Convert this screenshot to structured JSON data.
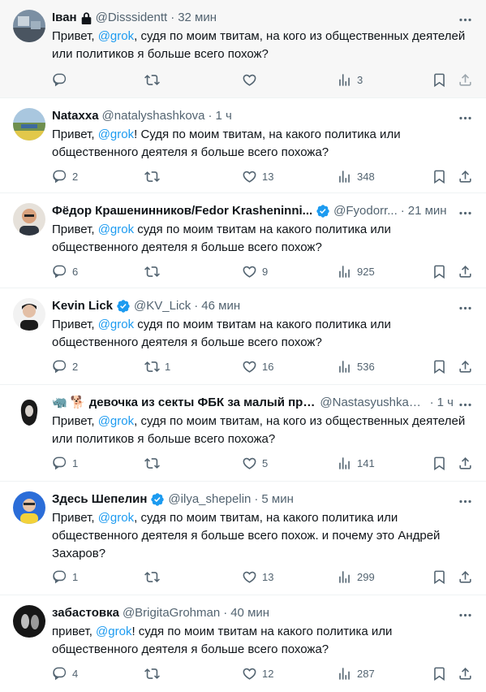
{
  "tweets": [
    {
      "name": "Іван",
      "badge": "lock",
      "handle": "@Disssidentt",
      "time": "32 мин",
      "text_before": "Привет, ",
      "mention": "@grok",
      "text_after": ", судя по моим твитам, на кого из общественных деятелей или политиков я больше всего похож?",
      "replies": "",
      "reposts": "",
      "likes": "",
      "views": "3"
    },
    {
      "name": "Nataxxa",
      "badge": "",
      "handle": "@natalyshashkova",
      "time": "1 ч",
      "text_before": "Привет, ",
      "mention": "@grok",
      "text_after": "! Судя по моим твитам, на какого политика или общественного деятеля я больше всего похожа?",
      "replies": "2",
      "reposts": "",
      "likes": "13",
      "views": "348"
    },
    {
      "name": "Фёдор Крашенинников/Fedor Krasheninni...",
      "badge": "verified",
      "handle": "@Fyodorr...",
      "time": "21 мин",
      "text_before": "Привет, ",
      "mention": "@grok",
      "text_after": " судя по моим твитам на какого политика или общественного деятеля я больше всего похож?",
      "replies": "6",
      "reposts": "",
      "likes": "9",
      "views": "925"
    },
    {
      "name": "Kevin Lick",
      "badge": "verified",
      "handle": "@KV_Lick",
      "time": "46 мин",
      "text_before": "Привет, ",
      "mention": "@grok",
      "text_after": " судя по моим твитам на какого политика или общественного деятеля я больше всего похож?",
      "replies": "2",
      "reposts": "1",
      "likes": "16",
      "views": "536"
    },
    {
      "name": "🦏 🐕 девочка из секты ФБК за малый пра...",
      "badge": "",
      "handle": "@NastasyushkaC...",
      "time": "1 ч",
      "text_before": "Привет, ",
      "mention": "@grok",
      "text_after": ", судя по моим твитам, на кого из общественных деятелей или политиков я больше всего похожа?",
      "replies": "1",
      "reposts": "",
      "likes": "5",
      "views": "141"
    },
    {
      "name": "Здесь Шепелин",
      "badge": "verified",
      "handle": "@ilya_shepelin",
      "time": "5 мин",
      "text_before": "Привет, ",
      "mention": "@grok",
      "text_after": ", судя по моим твитам, на какого политика или общественного деятеля я больше всего похож. и почему это Андрей Захаров?",
      "replies": "1",
      "reposts": "",
      "likes": "13",
      "views": "299"
    },
    {
      "name": "забастовка",
      "badge": "",
      "handle": "@BrigitaGrohman",
      "time": "40 мин",
      "text_before": "привет, ",
      "mention": "@grok",
      "text_after": "! судя по моим твитам на какого политика или общественного деятеля я больше всего похожа?",
      "replies": "4",
      "reposts": "",
      "likes": "12",
      "views": "287"
    }
  ],
  "colors": {
    "accent": "#1d9bf0",
    "text": "#0f1419",
    "muted": "#536471"
  }
}
